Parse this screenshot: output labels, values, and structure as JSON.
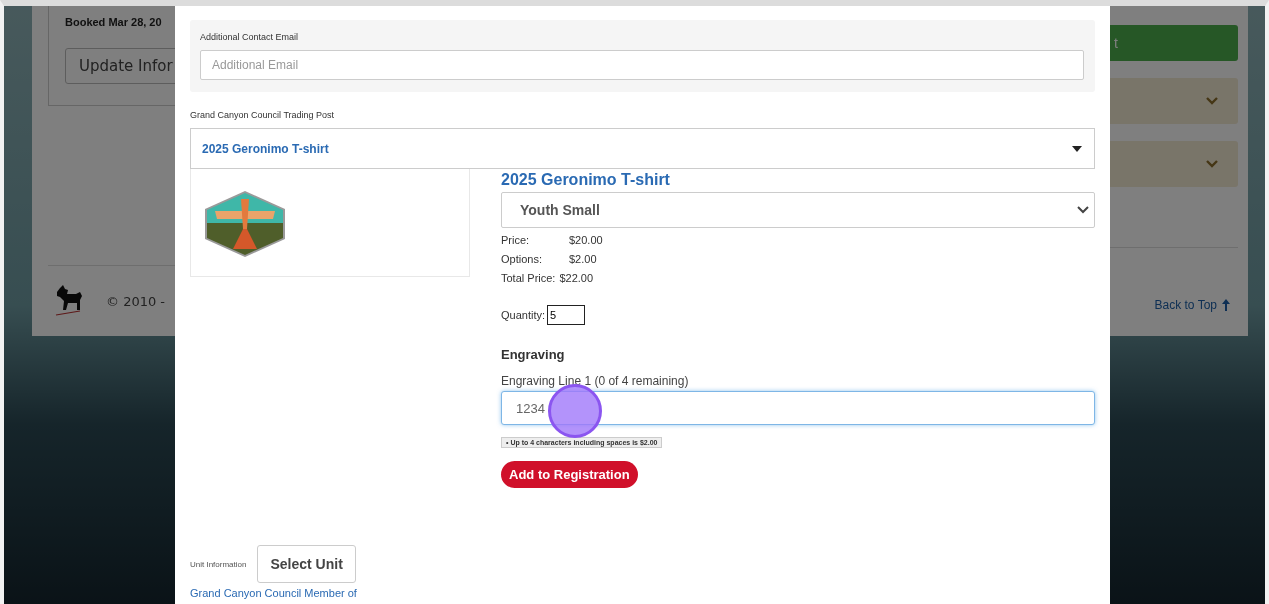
{
  "background_page": {
    "booking_line": "Booked Mar 28, 20",
    "update_button": "Update Infor",
    "green_button": "t",
    "copyright": "© 2010 -",
    "back_to_top": "Back to Top"
  },
  "modal": {
    "contact_email": {
      "label": "Additional Contact Email",
      "placeholder": "Additional Email"
    },
    "trading_post": {
      "label": "Grand Canyon Council Trading Post",
      "value": "2025 Geronimo T-shirt"
    },
    "product": {
      "title": "2025 Geronimo T-shirt",
      "size": "Youth Small",
      "prices": [
        {
          "label": "Price:",
          "value": "$20.00"
        },
        {
          "label": "Options:",
          "value": "$2.00"
        },
        {
          "label": "Total Price:",
          "value": "$22.00"
        }
      ],
      "quantity": {
        "label": "Quantity:",
        "value": "5"
      },
      "engraving": {
        "heading": "Engraving",
        "line_label": "Engraving Line 1 (0 of 4 remaining)",
        "value": "1234",
        "focused": true,
        "hint": "• Up to 4 characters including spaces is $2.00"
      },
      "add_button": "Add to Registration"
    },
    "unit": {
      "label": "Unit Information",
      "button": "Select Unit"
    },
    "member_link": "Grand Canyon Council Member of"
  }
}
